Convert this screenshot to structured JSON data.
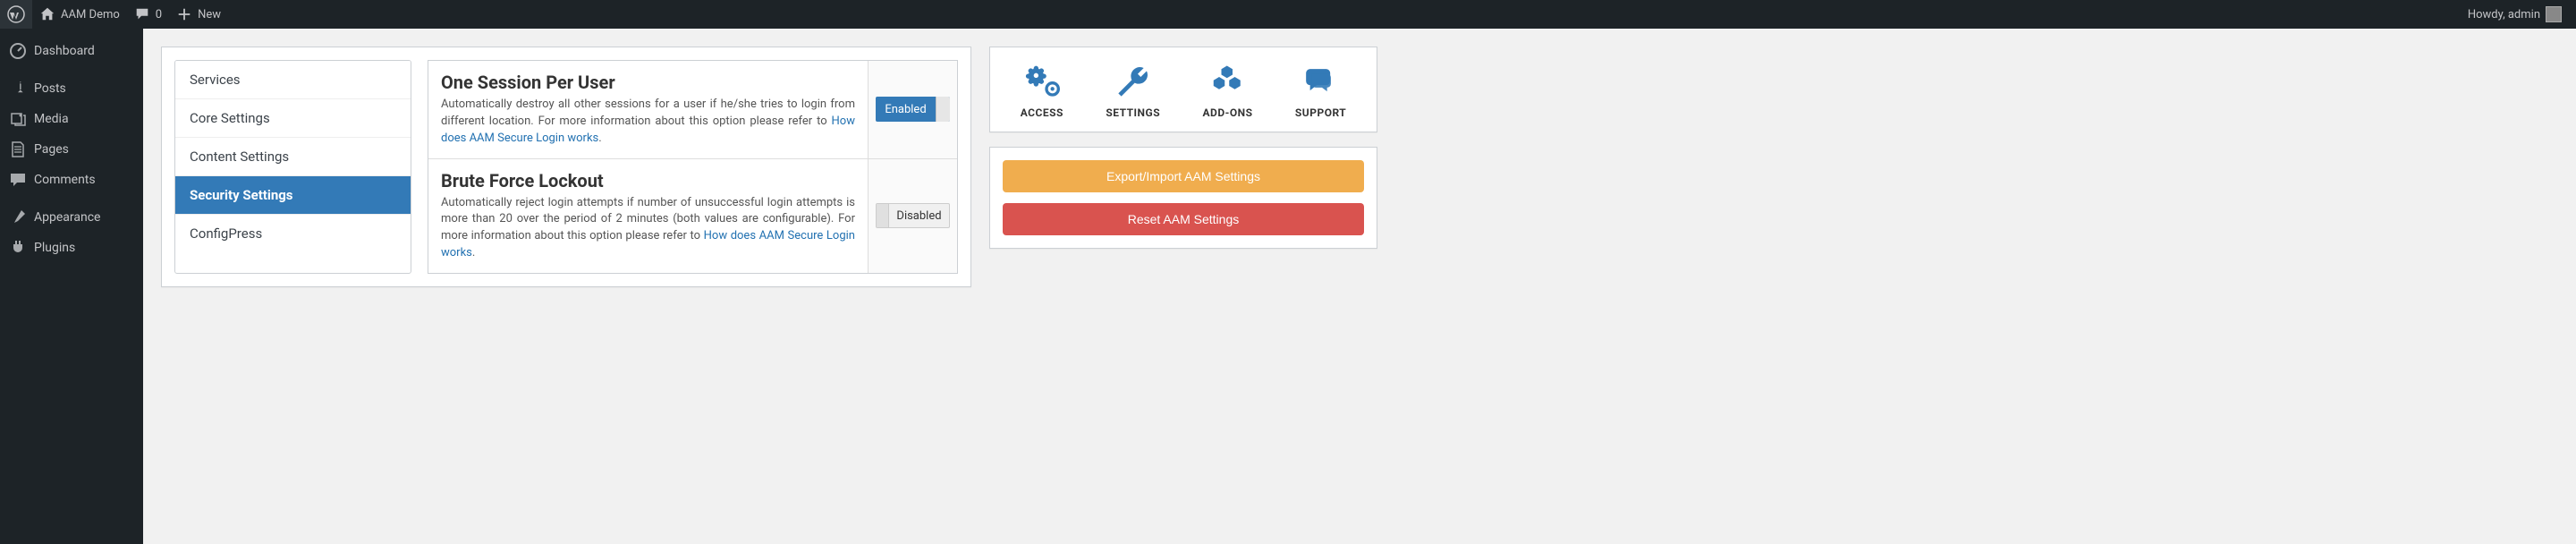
{
  "adminbar": {
    "site_name": "AAM Demo",
    "comment_count": "0",
    "new_label": "New",
    "howdy": "Howdy, admin"
  },
  "sidebar": {
    "items": [
      {
        "label": "Dashboard",
        "icon": "dashboard"
      },
      {
        "label": "Posts",
        "icon": "pin"
      },
      {
        "label": "Media",
        "icon": "media"
      },
      {
        "label": "Pages",
        "icon": "pages"
      },
      {
        "label": "Comments",
        "icon": "comments"
      },
      {
        "label": "Appearance",
        "icon": "brush"
      },
      {
        "label": "Plugins",
        "icon": "plug"
      }
    ]
  },
  "tabs": [
    {
      "label": "Services"
    },
    {
      "label": "Core Settings"
    },
    {
      "label": "Content Settings"
    },
    {
      "label": "Security Settings",
      "active": true
    },
    {
      "label": "ConfigPress"
    }
  ],
  "settings": {
    "rows": [
      {
        "title": "One Session Per User",
        "desc_pre": "Automatically destroy all other sessions for a user if he/she tries to login from different location. For more information about this option please refer to ",
        "link": "How does AAM Secure Login works",
        "desc_post": ".",
        "toggle": "Enabled"
      },
      {
        "title": "Brute Force Lockout",
        "desc_pre": "Automatically reject login attempts if number of unsuccessful login attempts is more than 20 over the period of 2 minutes (both values are configurable). For more information about this option please refer to ",
        "link": "How does AAM Secure Login works",
        "desc_post": ".",
        "toggle": "Disabled"
      }
    ]
  },
  "quicklinks": [
    {
      "label": "ACCESS",
      "icon": "gears"
    },
    {
      "label": "SETTINGS",
      "icon": "wrench"
    },
    {
      "label": "ADD-ONS",
      "icon": "cubes"
    },
    {
      "label": "SUPPORT",
      "icon": "chat"
    }
  ],
  "buttons": {
    "export": "Export/Import AAM Settings",
    "reset": "Reset AAM Settings"
  }
}
